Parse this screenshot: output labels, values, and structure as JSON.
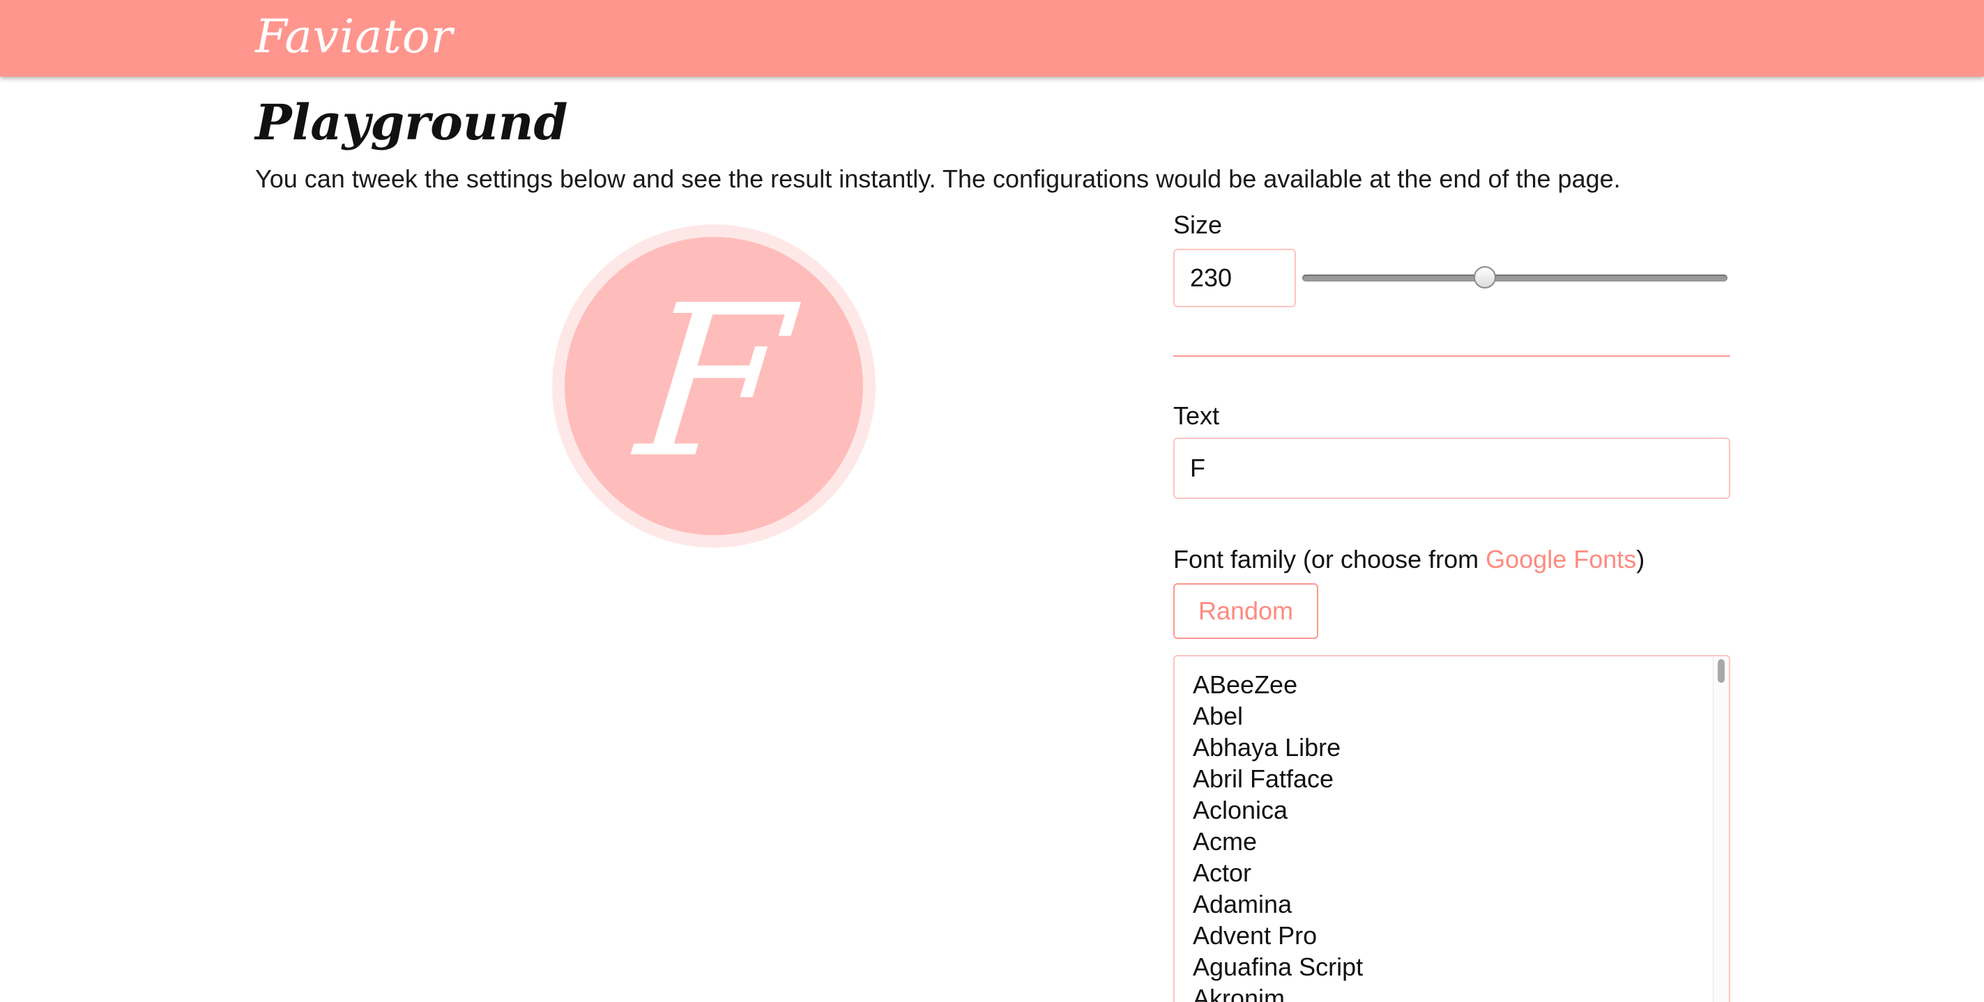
{
  "header": {
    "brand": "Faviator"
  },
  "page": {
    "title": "Playground",
    "intro": "You can tweek the settings below and see the result instantly. The configurations would be available at the end of the page."
  },
  "preview": {
    "letter": "F",
    "outer_color": "#fee8e7",
    "inner_color": "#febdbb",
    "text_color": "#ffffff"
  },
  "size": {
    "label": "Size",
    "value": "230",
    "slider_fraction": 0.43
  },
  "text_setting": {
    "label": "Text",
    "value": "F"
  },
  "font_family": {
    "label_prefix": "Font family (or choose from ",
    "link_text": "Google Fonts",
    "label_suffix": ")",
    "random_label": "Random",
    "options": [
      "ABeeZee",
      "Abel",
      "Abhaya Libre",
      "Abril Fatface",
      "Aclonica",
      "Acme",
      "Actor",
      "Adamina",
      "Advent Pro",
      "Aguafina Script",
      "Akronim"
    ]
  },
  "colors": {
    "accent": "#ff968e",
    "link": "#ff8a80",
    "input_border": "#ffc4c0"
  }
}
